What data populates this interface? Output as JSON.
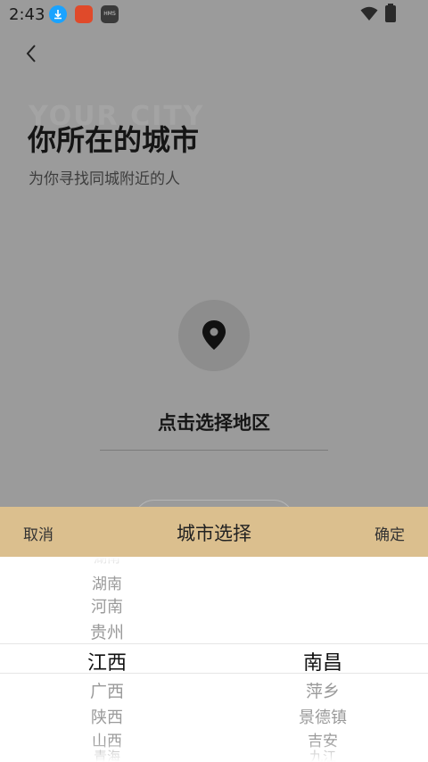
{
  "status_bar": {
    "time": "2:43",
    "hms_label": "HMS"
  },
  "page": {
    "watermark": "YOUR CITY",
    "title": "你所在的城市",
    "subtitle": "为你寻找同城附近的人",
    "select_region": "点击选择地区"
  },
  "picker": {
    "cancel": "取消",
    "title": "城市选择",
    "confirm": "确定",
    "provinces": {
      "above": [
        "湖南",
        "河南",
        "贵州"
      ],
      "above_partial": "湖南",
      "selected": "江西",
      "below": [
        "广西",
        "陕西",
        "山西"
      ],
      "below_partial": "青海"
    },
    "cities": {
      "selected": "南昌",
      "below": [
        "萍乡",
        "景德镇",
        "吉安"
      ],
      "below_partial": "九江"
    }
  },
  "colors": {
    "overlay_bg": "#9b9b9b",
    "picker_header": "#dbbf8e",
    "picker_body": "#ffffff"
  },
  "icons": [
    "download-icon",
    "app-icon",
    "hms-icon",
    "wifi-icon",
    "battery-icon",
    "back-chevron-icon",
    "location-pin-icon"
  ]
}
